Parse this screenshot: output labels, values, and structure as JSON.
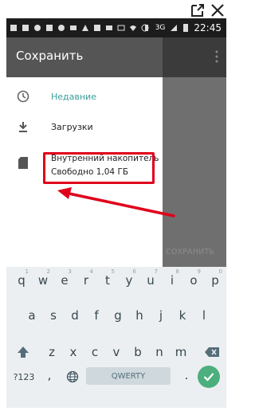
{
  "status_bar": {
    "network": "3G",
    "time": "22:45"
  },
  "drawer": {
    "title": "Сохранить",
    "items": [
      {
        "label": "Недавние",
        "icon": "clock-icon"
      },
      {
        "label": "Загрузки",
        "icon": "download-icon"
      }
    ],
    "storage": {
      "name": "Внутренний накопитель",
      "free": "Свободно 1,04 ГБ",
      "icon": "sd-card-icon"
    }
  },
  "background_app": {
    "save_button_label": "СОХРАНИТЬ"
  },
  "keyboard": {
    "row1": [
      {
        "k": "q",
        "h": "1"
      },
      {
        "k": "w",
        "h": "2"
      },
      {
        "k": "e",
        "h": "3"
      },
      {
        "k": "r",
        "h": "4"
      },
      {
        "k": "t",
        "h": "5"
      },
      {
        "k": "y",
        "h": "6"
      },
      {
        "k": "u",
        "h": "7"
      },
      {
        "k": "i",
        "h": "8"
      },
      {
        "k": "o",
        "h": "9"
      },
      {
        "k": "p",
        "h": "0"
      }
    ],
    "row2": [
      "a",
      "s",
      "d",
      "f",
      "g",
      "h",
      "j",
      "k",
      "l"
    ],
    "row3": [
      "z",
      "x",
      "c",
      "v",
      "b",
      "n",
      "m"
    ],
    "symbols_label": "?123",
    "comma": ",",
    "period": ".",
    "space_label": "QWERTY"
  },
  "colors": {
    "accent_teal": "#3a9d9a",
    "highlight_red": "#e0001b",
    "enter_green": "#4caf7d"
  }
}
